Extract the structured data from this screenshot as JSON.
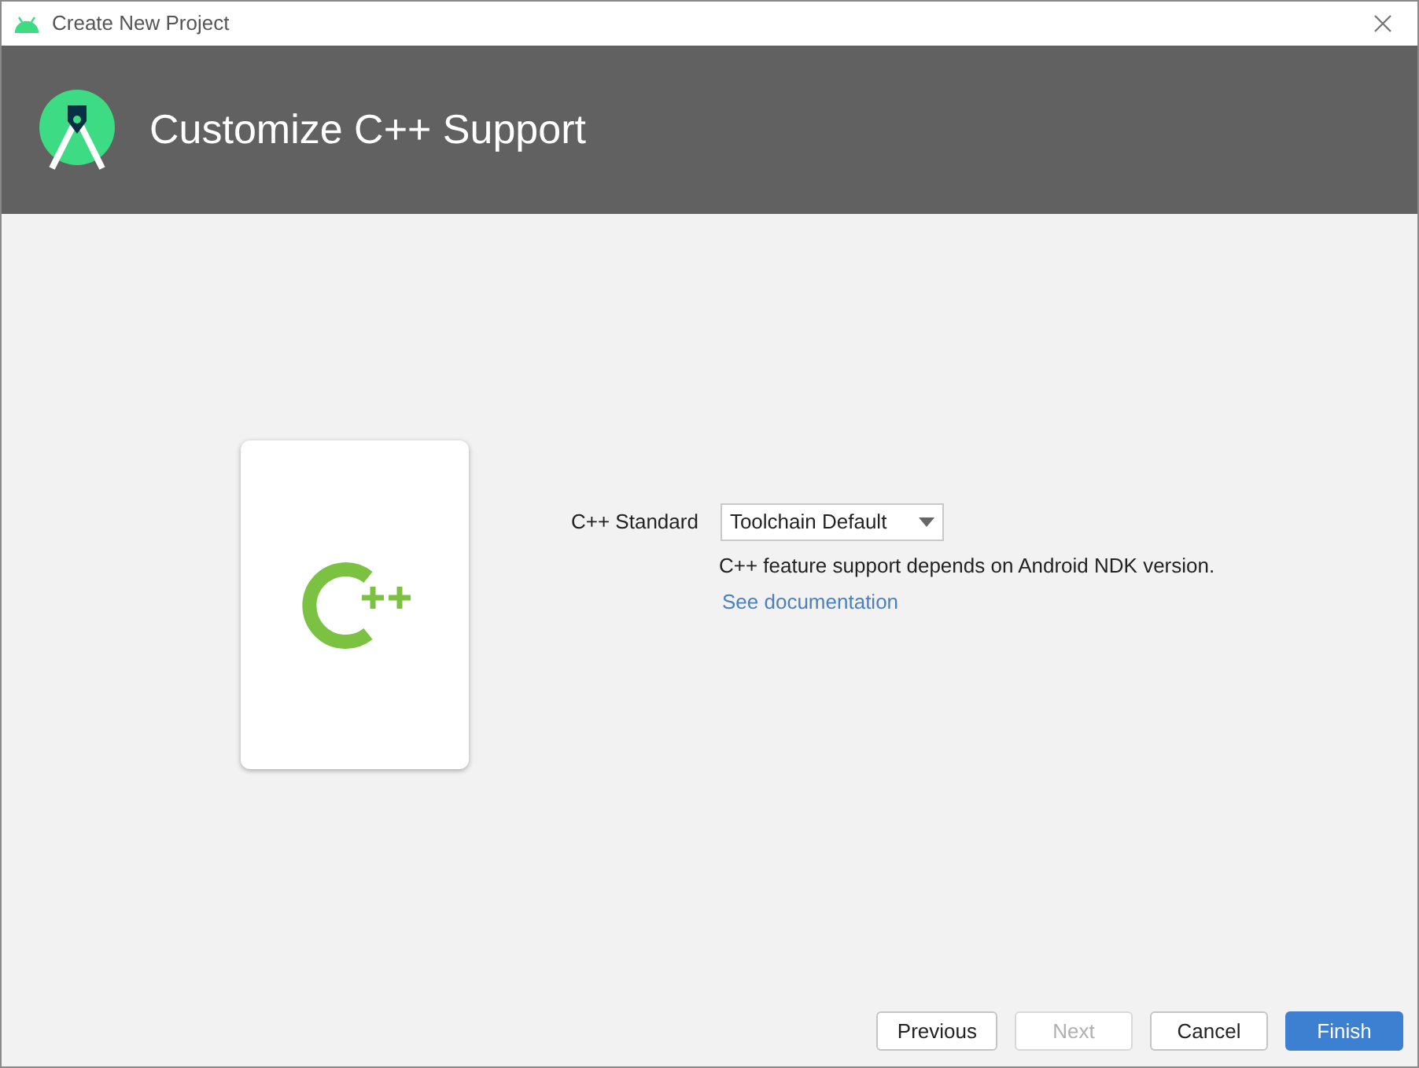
{
  "window": {
    "title": "Create New Project"
  },
  "header": {
    "title": "Customize C++ Support"
  },
  "form": {
    "label": "C++ Standard",
    "dropdown": {
      "value": "Toolchain Default"
    },
    "note": "C++ feature support depends on Android NDK version.",
    "link": "See documentation"
  },
  "buttons": [
    {
      "label": "Previous",
      "kind": "normal",
      "disabled": false
    },
    {
      "label": "Next",
      "kind": "normal",
      "disabled": true
    },
    {
      "label": "Cancel",
      "kind": "normal",
      "disabled": false
    },
    {
      "label": "Finish",
      "kind": "primary",
      "disabled": false
    }
  ]
}
